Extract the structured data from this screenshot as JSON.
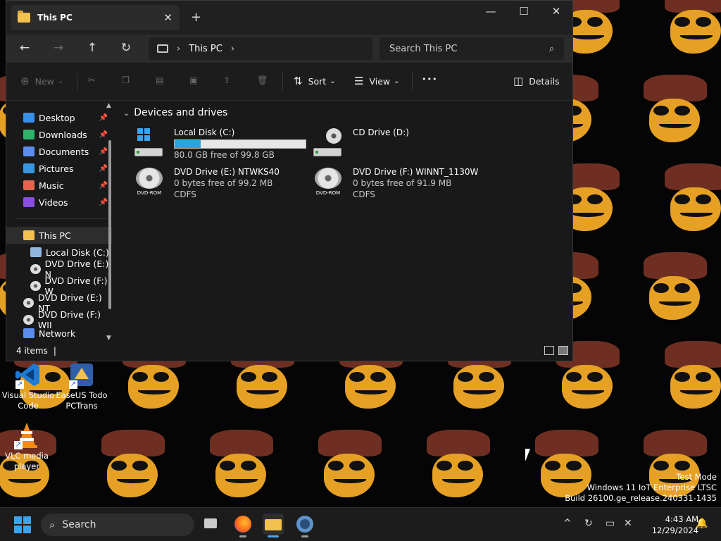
{
  "window": {
    "tab_title": "This PC",
    "tab_close": "✕",
    "new_tab": "+",
    "minimize": "—",
    "maximize": "☐",
    "close": "✕"
  },
  "navigation": {
    "back": "←",
    "forward": "→",
    "up": "↑",
    "refresh": "↻",
    "breadcrumb_sep": "›",
    "breadcrumb": "This PC",
    "search_placeholder": "Search This PC",
    "search_icon": "⌕"
  },
  "toolbar": {
    "new_label": "New",
    "sort_label": "Sort",
    "view_label": "View",
    "more_label": "•••",
    "details_label": "Details",
    "dropdown": "⌄"
  },
  "sidebar": {
    "quick_access": [
      {
        "label": "Desktop",
        "icon": "desktop-icon",
        "color": "#3a8ee6"
      },
      {
        "label": "Downloads",
        "icon": "downloads-icon",
        "color": "#2fb36b"
      },
      {
        "label": "Documents",
        "icon": "documents-icon",
        "color": "#5b8def"
      },
      {
        "label": "Pictures",
        "icon": "pictures-icon",
        "color": "#3a96dd"
      },
      {
        "label": "Music",
        "icon": "music-icon",
        "color": "#e0664d"
      },
      {
        "label": "Videos",
        "icon": "videos-icon",
        "color": "#8a4fdc"
      }
    ],
    "pin": "📌",
    "this_pc": "This PC",
    "this_pc_children": [
      "Local Disk (C:)",
      "DVD Drive (E:) N",
      "DVD Drive (F:) W"
    ],
    "drives": [
      "DVD Drive (E:) NT",
      "DVD Drive (F:) WII"
    ],
    "network": "Network"
  },
  "main": {
    "group_title": "Devices and drives",
    "group_chevron": "⌄",
    "drives": [
      {
        "name": "Local Disk (C:)",
        "free": "80.0 GB free of 99.8 GB",
        "used_fraction": 0.198,
        "type": "hdd"
      },
      {
        "name": "CD Drive (D:)",
        "type": "cd"
      },
      {
        "name": "DVD Drive (E:) NTWKS40",
        "free": "0 bytes free of 99.2 MB",
        "fs": "CDFS",
        "type": "dvd"
      },
      {
        "name": "DVD Drive (F:) WINNT_1130W",
        "free": "0 bytes free of 91.9 MB",
        "fs": "CDFS",
        "type": "dvd"
      }
    ],
    "rom_tag": "DVD-ROM"
  },
  "status": {
    "count": "4 items",
    "separator": "|"
  },
  "desktop": {
    "icons": [
      {
        "label": "Visual Studio Code"
      },
      {
        "label": "EaseUS Todo PCTrans"
      },
      {
        "label": "VLC media player"
      }
    ],
    "shortcut_arrow": "↗"
  },
  "watermark": {
    "line1": "Test Mode",
    "line2": "Windows 11 IoT Enterprise LTSC",
    "line3": "Build 26100.ge_release.240331-1435"
  },
  "taskbar": {
    "search_label": "Search",
    "time": "4:43 AM",
    "date": "12/29/2024",
    "tray_chevron": "^"
  }
}
